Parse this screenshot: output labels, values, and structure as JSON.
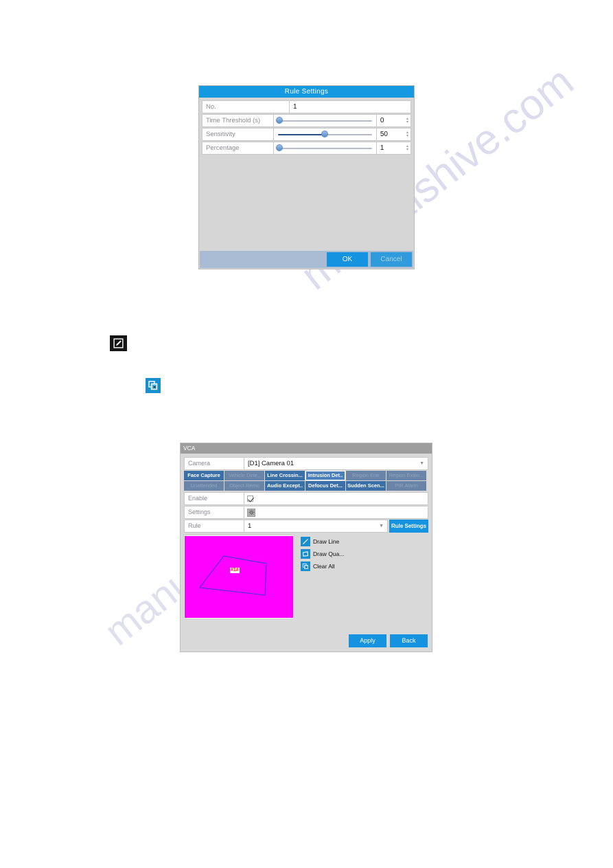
{
  "watermark": {
    "line1": "manualshive.com",
    "line2": "manualshive.com"
  },
  "rule_settings_dialog": {
    "title": "Rule Settings",
    "rows": [
      {
        "label": "No.",
        "type": "text",
        "value": "1"
      },
      {
        "label": "Time Threshold (s)",
        "type": "slider",
        "value": "0",
        "slider_percent": 2
      },
      {
        "label": "Sensitivity",
        "type": "slider",
        "value": "50",
        "slider_percent": 50
      },
      {
        "label": "Percentage",
        "type": "slider",
        "value": "1",
        "slider_percent": 2
      }
    ],
    "ok_label": "OK",
    "cancel_label": "Cancel"
  },
  "inline_icons": {
    "edit_icon_name": "edit-pencil-icon",
    "clear_icon_name": "clear-all-icon"
  },
  "vca_window": {
    "title": "VCA",
    "camera_label": "Camera",
    "camera_value": "[D1] Camera 01",
    "tabs": [
      {
        "label": "Face Capture",
        "state": "on"
      },
      {
        "label": "Vehicle Dete..",
        "state": "off"
      },
      {
        "label": "Line Crossin...",
        "state": "on"
      },
      {
        "label": "Intrusion Det..",
        "state": "selected"
      },
      {
        "label": "Region Entr",
        "state": "off"
      },
      {
        "label": "Region Exitin...",
        "state": "off"
      },
      {
        "label": "Unattended",
        "state": "off"
      },
      {
        "label": "Object Remo",
        "state": "off"
      },
      {
        "label": "Audio Except..",
        "state": "on"
      },
      {
        "label": "Defocus Det...",
        "state": "on"
      },
      {
        "label": "Sudden Scen...",
        "state": "on"
      },
      {
        "label": "PIR Alarm",
        "state": "off"
      }
    ],
    "enable_label": "Enable",
    "enable_checked": true,
    "settings_label": "Settings",
    "rule_label": "Rule",
    "rule_value": "1",
    "rule_settings_button": "Rule Settings",
    "draw_area_region_label": "#1#",
    "tools": [
      {
        "label": "Draw Line",
        "icon": "draw-line-icon"
      },
      {
        "label": "Draw Qua...",
        "icon": "draw-quadrilateral-icon"
      },
      {
        "label": "Clear All",
        "icon": "clear-all-icon"
      }
    ],
    "apply_label": "Apply",
    "back_label": "Back"
  },
  "colors": {
    "accent_blue": "#1593e0",
    "title_blue": "#1599e0",
    "dialog_gray": "#d6d6d6",
    "footer_blue_gray": "#aabbd4",
    "magenta_preview": "#ff00ff",
    "tab_active": "#3b6fa8",
    "tab_inactive": "#6a84a8"
  }
}
